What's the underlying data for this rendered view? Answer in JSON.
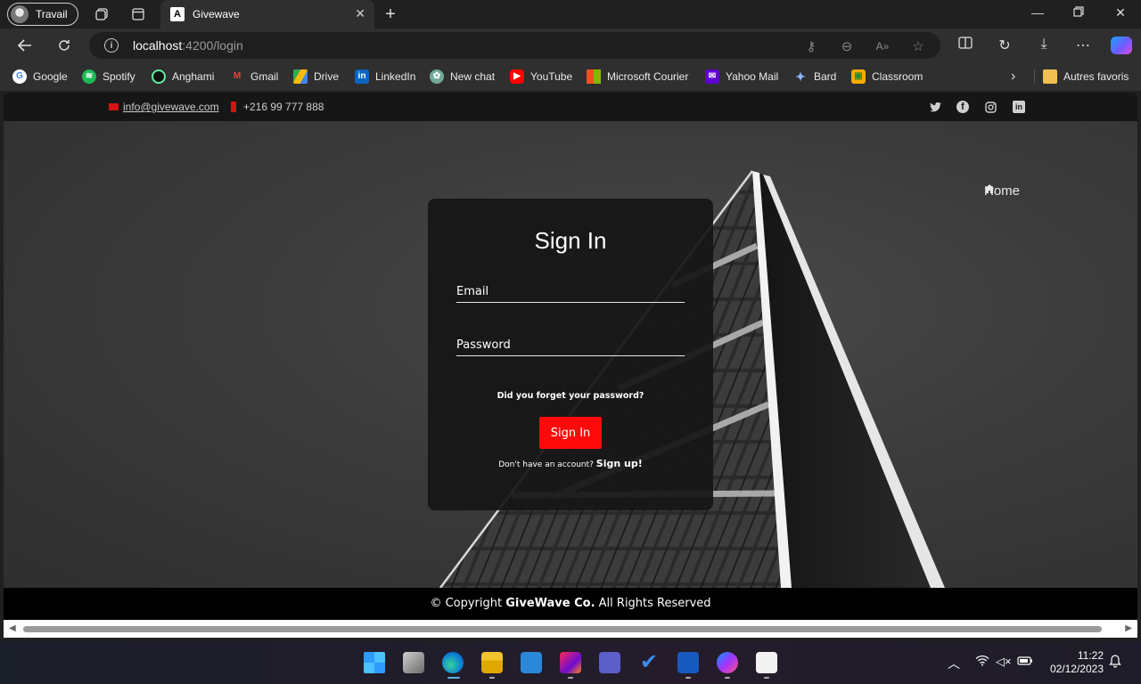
{
  "browser": {
    "profile_label": "Travail",
    "tab_title": "Givewave",
    "tab_favicon": "A",
    "url_host": "localhost",
    "url_path": ":4200/login"
  },
  "bookmarks": [
    {
      "label": "Google",
      "icon": "google-icon",
      "color": "#ffffff"
    },
    {
      "label": "Spotify",
      "icon": "spotify-icon",
      "color": "#1db954"
    },
    {
      "label": "Anghami",
      "icon": "anghami-icon",
      "color": "#8b5cf6"
    },
    {
      "label": "Gmail",
      "icon": "gmail-icon",
      "color": "#ea4335"
    },
    {
      "label": "Drive",
      "icon": "drive-icon",
      "color": "#34a853"
    },
    {
      "label": "LinkedIn",
      "icon": "linkedin-icon",
      "color": "#0a66c2"
    },
    {
      "label": "New chat",
      "icon": "chatgpt-icon",
      "color": "#74aa9c"
    },
    {
      "label": "YouTube",
      "icon": "youtube-icon",
      "color": "#ff0000"
    },
    {
      "label": "Microsoft Courier",
      "icon": "microsoft-icon",
      "color": "#f25022"
    },
    {
      "label": "Yahoo Mail",
      "icon": "yahoo-mail-icon",
      "color": "#6001d2"
    },
    {
      "label": "Bard",
      "icon": "bard-icon",
      "color": "#8ab4f8"
    },
    {
      "label": "Classroom",
      "icon": "classroom-icon",
      "color": "#f9ab00"
    }
  ],
  "other_favorites": "Autres favoris",
  "site": {
    "contact_email": "info@givewave.com",
    "contact_phone": "+216 99 777 888",
    "nav_home": "Home",
    "footer_prefix": "© Copyright ",
    "footer_brand": "GiveWave Co.",
    "footer_suffix": " All Rights Reserved"
  },
  "login": {
    "title": "Sign In",
    "email_label": "Email",
    "password_label": "Password",
    "forgot_text": "Did you forget your password?",
    "submit_label": "Sign In",
    "no_account_text": "Don't have an account? ",
    "signup_link": "Sign up!"
  },
  "taskbar": {
    "time": "11:22",
    "date": "02/12/2023"
  }
}
